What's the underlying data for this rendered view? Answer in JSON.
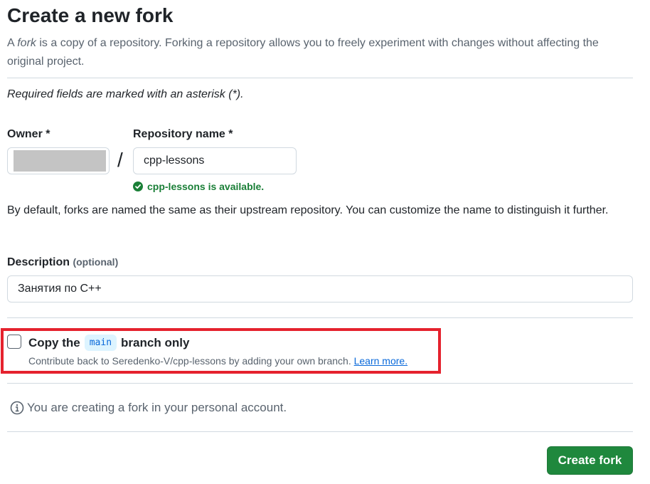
{
  "page": {
    "title": "Create a new fork",
    "lead": {
      "prefix": "A ",
      "fork_word": "fork",
      "rest": " is a copy of a repository. Forking a repository allows you to freely experiment with changes without affecting the original project."
    },
    "required_note": "Required fields are marked with an asterisk (*)."
  },
  "owner": {
    "label": "Owner *"
  },
  "separator": "/",
  "repository_name": {
    "label": "Repository name *",
    "value": "cpp-lessons",
    "availability": "cpp-lessons is available."
  },
  "naming_hint": "By default, forks are named the same as their upstream repository. You can customize the name to distinguish it further.",
  "description": {
    "label": "Description",
    "optional": "(optional)",
    "value": "Занятия по С++"
  },
  "copy_branch": {
    "prefix": "Copy the",
    "branch": "main",
    "suffix": "branch only",
    "checked": false,
    "subtext": "Contribute back to Seredenko-V/cpp-lessons by adding your own branch.",
    "learn_more": "Learn more."
  },
  "notice": "You are creating a fork in your personal account.",
  "create_button": "Create fork",
  "colors": {
    "primary_button": "#1f883d",
    "success": "#1a7f37",
    "link": "#0969da",
    "highlight_border": "#e5222e"
  }
}
